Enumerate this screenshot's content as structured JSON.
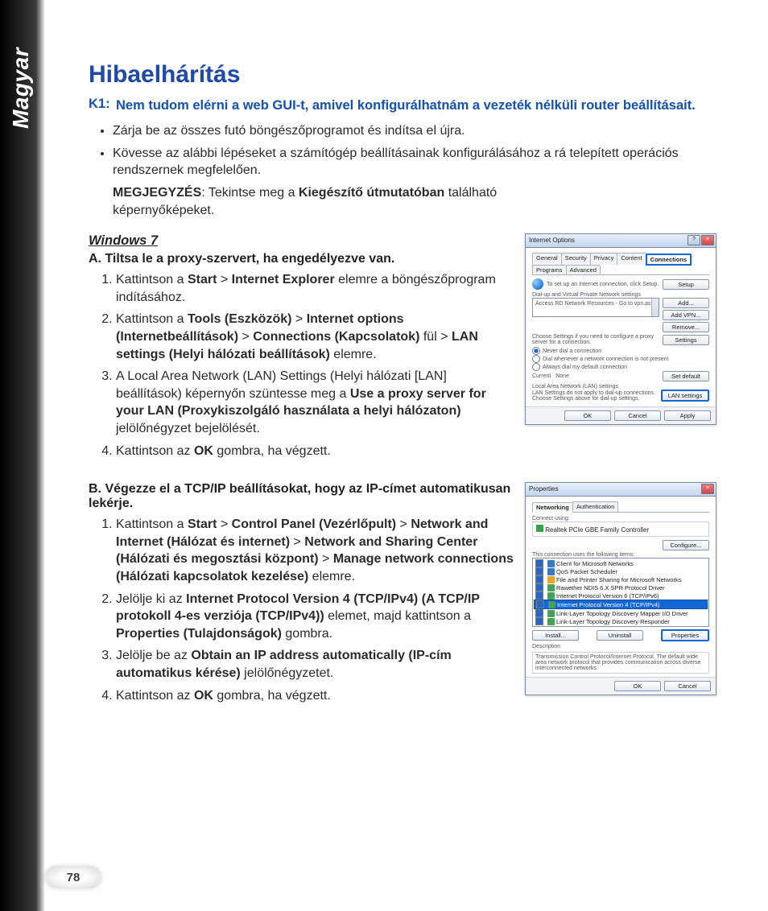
{
  "side_tab": "Magyar",
  "page_number": "78",
  "title": "Hibaelhárítás",
  "k1_label": "K1:",
  "k1_text": "Nem tudom elérni a web GUI-t, amivel konfigurálhatnám a vezeték nélküli router beállításait.",
  "bullets": [
    "Zárja be az összes futó böngészőprogramot és indítsa el újra.",
    "Kövesse az alábbi lépéseket a számítógép beállításainak konfigurálásához a rá telepített operációs rendszernek megfelelően."
  ],
  "note_pre": "MEGJEGYZÉS",
  "note_mid1": ":  Tekintse meg a ",
  "note_bold": "Kiegészítő útmutatóban",
  "note_post": " található képernyőképeket.",
  "os_head": "Windows 7",
  "secA": {
    "head": "A.  Tiltsa le a proxy-szervert, ha engedélyezve van.",
    "s1_a": "Kattintson a ",
    "s1_b": "Start",
    "s1_c": " > ",
    "s1_d": "Internet Explorer",
    "s1_e": " elemre a böngészőprogram indításához.",
    "s2_a": "Kattintson a ",
    "s2_b": "Tools (Eszközök)",
    "s2_c": " > ",
    "s2_d": "Internet options (Internetbeállítások)",
    "s2_e": " > ",
    "s2_f": "Connections (Kapcsolatok)",
    "s2_g": " fül > ",
    "s2_h": "LAN settings (Helyi hálózati beállítások)",
    "s2_i": " elemre.",
    "s3_a": "A Local Area Network (LAN) Settings (Helyi hálózati [LAN] beállítások) képernyőn szüntesse meg a ",
    "s3_b": "Use a proxy server for your LAN (Proxykiszolgáló használata a helyi hálózaton)",
    "s3_c": " jelölőnégyzet bejelölését.",
    "s4_a": "Kattintson az ",
    "s4_b": "OK",
    "s4_c": " gombra, ha végzett."
  },
  "secB": {
    "head": "B.  Végezze el a TCP/IP beállításokat, hogy az IP-címet automatikusan lekérje.",
    "s1_a": "Kattintson a ",
    "s1_b": "Start",
    "s1_c": " > ",
    "s1_d": "Control Panel (Vezérlőpult)",
    "s1_e": " > ",
    "s1_f": "Network and Internet (Hálózat és internet)",
    "s1_g": " > ",
    "s1_h": "Network and Sharing Center (Hálózati és megosztási központ)",
    "s1_i": " > ",
    "s1_j": "Manage network connections (Hálózati kapcsolatok kezelése)",
    "s1_k": " elemre.",
    "s2_a": "Jelölje ki az ",
    "s2_b": "Internet Protocol Version 4 (TCP/IPv4) (A TCP/IP protokoll 4-es verziója (TCP/IPv4))",
    "s2_c": " elemet, majd kattintson a ",
    "s2_d": "Properties (Tulajdonságok)",
    "s2_e": " gombra.",
    "s3_a": "Jelölje be az ",
    "s3_b": "Obtain an IP address automatically (IP-cím automatikus kérése)",
    "s3_c": " jelölőnégyzetet.",
    "s4_a": "Kattintson az ",
    "s4_b": "OK",
    "s4_c": " gombra, ha végzett."
  },
  "dlg1": {
    "title": "Internet Options",
    "tabs": [
      "General",
      "Security",
      "Privacy",
      "Content",
      "Connections",
      "Programs",
      "Advanced"
    ],
    "setup_hint": "To set up an Internet connection, click Setup.",
    "setup_btn": "Setup",
    "vpn_head": "Dial-up and Virtual Private Network settings",
    "vpn_item": "Access RD Network Resources - Go to vpn.as",
    "add": "Add...",
    "addvpn": "Add VPN...",
    "remove": "Remove...",
    "cfg_hint": "Choose Settings if you need to configure a proxy server for a connection.",
    "settings": "Settings",
    "r1": "Never dial a connection",
    "r2": "Dial whenever a network connection is not present",
    "r3": "Always dial my default connection",
    "cur": "Current",
    "none": "None",
    "setdef": "Set default",
    "lan_head": "Local Area Network (LAN) settings",
    "lan_hint": "LAN Settings do not apply to dial-up connections. Choose Settings above for dial-up settings.",
    "lan_btn": "LAN settings",
    "ok": "OK",
    "cancel": "Cancel",
    "apply": "Apply"
  },
  "dlg2": {
    "title": "Properties",
    "tabs": [
      "Networking",
      "Authentication"
    ],
    "connect_using": "Connect using:",
    "adapter": "Realtek PCIe GBE Family Controller",
    "configure": "Configure...",
    "list_head": "This connection uses the following items:",
    "items": [
      "Client for Microsoft Networks",
      "QoS Packet Scheduler",
      "File and Printer Sharing for Microsoft Networks",
      "Rawether NDIS 6.X SPR Protocol Driver",
      "Internet Protocol Version 6 (TCP/IPv6)",
      "Internet Protocol Version 4 (TCP/IPv4)",
      "Link-Layer Topology Discovery Mapper I/O Driver",
      "Link-Layer Topology Discovery Responder"
    ],
    "install": "Install...",
    "uninstall": "Uninstall",
    "properties": "Properties",
    "desc_head": "Description",
    "desc_text": "Transmission Control Protocol/Internet Protocol. The default wide area network protocol that provides communication across diverse interconnected networks.",
    "ok": "OK",
    "cancel": "Cancel"
  }
}
